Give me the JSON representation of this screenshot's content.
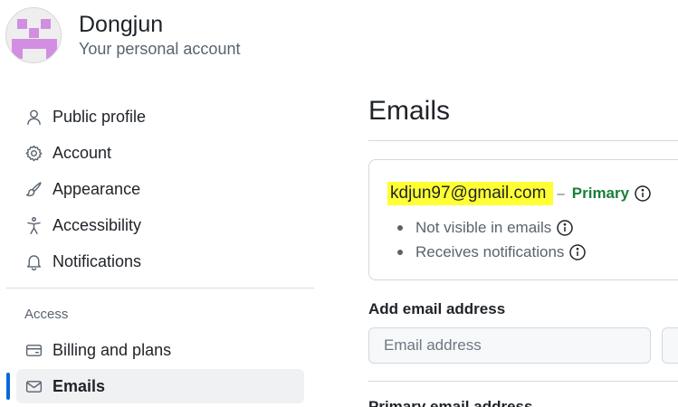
{
  "header": {
    "name": "Dongjun",
    "subtitle": "Your personal account"
  },
  "sidebar": {
    "items": [
      {
        "label": "Public profile",
        "icon": "person-icon"
      },
      {
        "label": "Account",
        "icon": "gear-icon"
      },
      {
        "label": "Appearance",
        "icon": "paintbrush-icon"
      },
      {
        "label": "Accessibility",
        "icon": "accessibility-icon"
      },
      {
        "label": "Notifications",
        "icon": "bell-icon"
      }
    ],
    "access_heading": "Access",
    "access_items": [
      {
        "label": "Billing and plans",
        "icon": "credit-card-icon"
      },
      {
        "label": "Emails",
        "icon": "mail-icon",
        "active": true
      }
    ]
  },
  "main": {
    "title": "Emails",
    "email": {
      "address": "kdjun97@gmail.com",
      "separator": "–",
      "status": "Primary",
      "details": [
        "Not visible in emails",
        "Receives notifications"
      ]
    },
    "add_email": {
      "label": "Add email address",
      "placeholder": "Email address"
    },
    "next_section_heading": "Primary email address"
  },
  "colors": {
    "accent": "#0969da",
    "primary_green": "#1a7f37",
    "highlight": "#ffff33",
    "active_bg": "#eff1f3"
  }
}
